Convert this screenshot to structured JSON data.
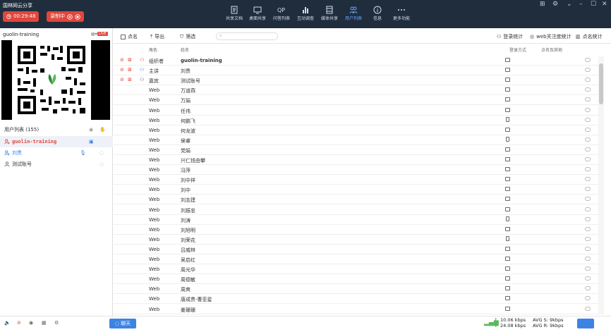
{
  "app": {
    "title": "国林网云分享"
  },
  "top": {
    "timer": "00:29:48",
    "record_label": "录制中",
    "tools": [
      {
        "label": "共享文档",
        "icon": "document-icon"
      },
      {
        "label": "桌面共享",
        "icon": "desktop-icon"
      },
      {
        "label": "问答列表",
        "icon": "qa-icon"
      },
      {
        "label": "互动调查",
        "icon": "survey-icon"
      },
      {
        "label": "媒体共享",
        "icon": "media-icon"
      },
      {
        "label": "用户列表",
        "icon": "users-icon"
      },
      {
        "label": "信息",
        "icon": "info-icon"
      },
      {
        "label": "更多功能",
        "icon": "more-icon"
      }
    ]
  },
  "left": {
    "room_name": "guolin-training",
    "live_badge": "LIVE",
    "user_list_label": "用户列表 (155)",
    "users": [
      {
        "name": "guolin-training"
      },
      {
        "name": "刘贵"
      },
      {
        "name": "测试账号"
      }
    ]
  },
  "toolbar": {
    "rollcall": "点名",
    "export": "导出",
    "filter": "筛选",
    "login_stats": "登录统计",
    "web_attention": "web关注度统计",
    "rollcall_stats": "点名统计"
  },
  "table": {
    "headers": {
      "role": "角色",
      "name": "姓名",
      "login": "登录方式",
      "rollcall": "点名及其他"
    },
    "rows": [
      {
        "role": "组织者",
        "name": "guolin-training",
        "dev": "pc"
      },
      {
        "role": "主讲",
        "name": "刘贵",
        "dev": "pc"
      },
      {
        "role": "嘉宾",
        "name": "测试账号",
        "dev": "pc"
      },
      {
        "role": "Web",
        "name": "万道燕",
        "dev": "pc"
      },
      {
        "role": "Web",
        "name": "万娟",
        "dev": "pc"
      },
      {
        "role": "Web",
        "name": "任伟",
        "dev": "pc"
      },
      {
        "role": "Web",
        "name": "何鹏飞",
        "dev": "mob"
      },
      {
        "role": "Web",
        "name": "何龙波",
        "dev": "pc"
      },
      {
        "role": "Web",
        "name": "侯睿",
        "dev": "mob"
      },
      {
        "role": "Web",
        "name": "党娟",
        "dev": "pc"
      },
      {
        "role": "Web",
        "name": "兴仁钱由攀",
        "dev": "pc"
      },
      {
        "role": "Web",
        "name": "冯萍",
        "dev": "pc"
      },
      {
        "role": "Web",
        "name": "刘中祥",
        "dev": "pc"
      },
      {
        "role": "Web",
        "name": "刘中",
        "dev": "pc"
      },
      {
        "role": "Web",
        "name": "刘志建",
        "dev": "pc"
      },
      {
        "role": "Web",
        "name": "刘振忠",
        "dev": "pc"
      },
      {
        "role": "Web",
        "name": "刘涛",
        "dev": "mob"
      },
      {
        "role": "Web",
        "name": "刘旭明",
        "dev": "pc"
      },
      {
        "role": "Web",
        "name": "刘荣花",
        "dev": "mob"
      },
      {
        "role": "Web",
        "name": "吕威林",
        "dev": "pc"
      },
      {
        "role": "Web",
        "name": "吴启红",
        "dev": "pc"
      },
      {
        "role": "Web",
        "name": "周光华",
        "dev": "pc"
      },
      {
        "role": "Web",
        "name": "周德敏",
        "dev": "pc"
      },
      {
        "role": "Web",
        "name": "周爽",
        "dev": "pc"
      },
      {
        "role": "Web",
        "name": "唐成贵-曹亚星",
        "dev": "pc"
      },
      {
        "role": "Web",
        "name": "姜珊珊",
        "dev": "pc"
      }
    ]
  },
  "bottom": {
    "chat": "聊天",
    "up_rate": "10.06 kbps",
    "down_rate": "24.08 kbps",
    "avg_s": "AVG S: 9kbps",
    "avg_r": "AVG R: 9kbps"
  },
  "colors": {
    "topbar": "#1f2d3d",
    "accent": "#e0463c",
    "active": "#6aa6ff",
    "chat": "#3d83e5"
  }
}
